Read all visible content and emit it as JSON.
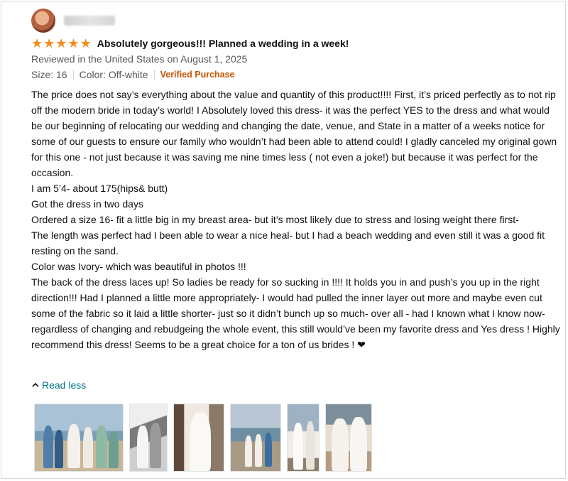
{
  "review": {
    "rating": 5,
    "title": "Absolutely gorgeous!!! Planned a wedding in a week!",
    "reviewed_line": "Reviewed in the United States on August 1, 2025",
    "size": "Size: 16",
    "color": "Color: Off-white",
    "verified": "Verified Purchase",
    "body": [
      "The price does not say’s everything about the value and quantity of this product!!!! First, it’s priced perfectly as to not rip off the modern bride in today’s world! I Absolutely loved this dress- it was the perfect YES to the dress and what would be our beginning of relocating our wedding and changing the date, venue, and State in a matter of a weeks notice for some of our guests to ensure our family who wouldn’t had been able to attend could! I gladly canceled my original gown for this one - not just because it was saving me nine times less ( not even a joke!) but because it was perfect for the occasion.",
      "I am 5’4- about 175(hips& butt)",
      "Got the dress in two days",
      "Ordered a size 16- fit a little big in my breast area- but it’s most likely due to stress and losing weight there first-",
      "The length was perfect had I been able to wear a nice heal- but I had a beach wedding and even still it was a good fit resting on the sand.",
      "Color was Ivory- which was beautiful in photos !!!",
      "The back of the dress laces up! So ladies be ready for so sucking in !!!! It holds you in and push’s you up in the right direction!!! Had I planned a little more appropriately- I would had pulled the inner layer out more and maybe even cut some of the fabric so it laid a little shorter- just so it didn’t bunch up so much- over all - had I known what I know now- regardless of changing and rebudgeing the whole event, this still would’ve been my favorite dress and Yes dress ! Highly recommend this dress! Seems to be a great choice for a ton of us brides ! ❤"
    ],
    "read_less": "Read less",
    "images": [
      "photo-1",
      "photo-2",
      "photo-3",
      "photo-4",
      "photo-5",
      "photo-6"
    ]
  },
  "colors": {
    "star": "#f48c1b",
    "verified": "#c45500",
    "link": "#007185",
    "meta": "#565959"
  }
}
